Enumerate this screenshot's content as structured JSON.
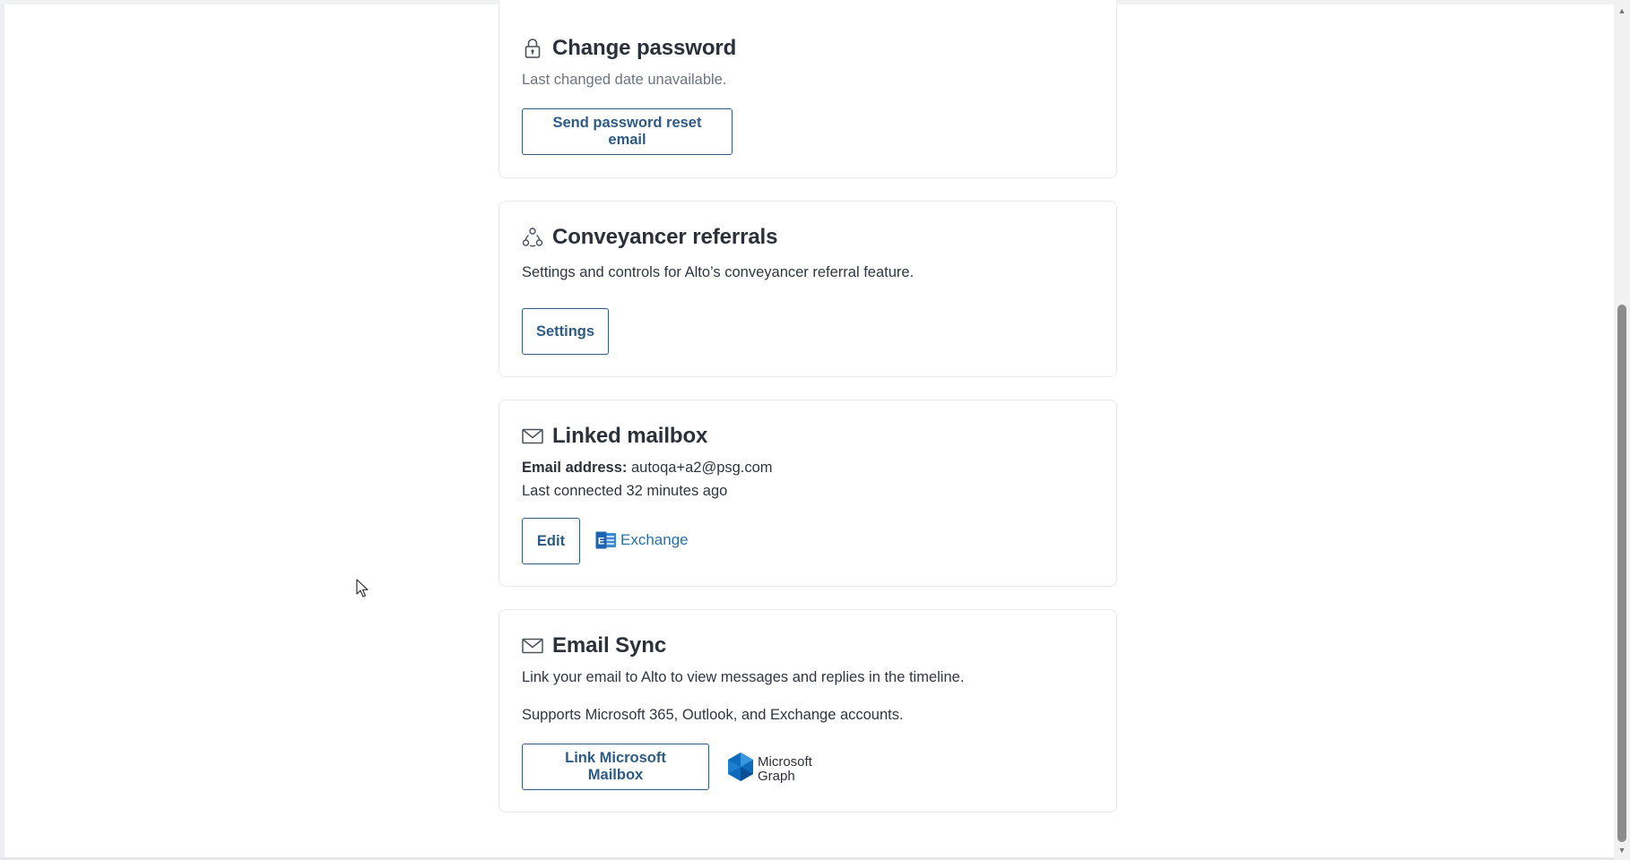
{
  "change_password": {
    "title": "Change password",
    "icon": "lock-icon",
    "subtitle": "Last changed date unavailable.",
    "button_label": "Send password reset email"
  },
  "conveyancer_referrals": {
    "title": "Conveyancer referrals",
    "icon": "referral-network-icon",
    "description": "Settings and controls for Alto’s conveyancer referral feature.",
    "button_label": "Settings"
  },
  "linked_mailbox": {
    "title": "Linked mailbox",
    "icon": "envelope-icon",
    "email_label": "Email address:",
    "email_value": "autoqa+a2@psg.com",
    "last_connected": "Last connected 32 minutes ago",
    "button_label": "Edit",
    "provider_label": "Exchange",
    "provider_icon": "exchange-logo-icon"
  },
  "email_sync": {
    "title": "Email Sync",
    "icon": "envelope-icon",
    "description": "Link your email to Alto to view messages and replies in the timeline.",
    "supports": "Supports Microsoft 365, Outlook, and Exchange accounts.",
    "button_label": "Link Microsoft Mailbox",
    "logo_line1": "Microsoft",
    "logo_line2": "Graph",
    "logo_icon": "microsoft-graph-logo-icon"
  },
  "colors": {
    "button_text": "#2e5b85",
    "button_border": "#2e5b85",
    "exchange_blue": "#2b6fa8",
    "graph_blue": "#0f6cbd",
    "heading": "#2b313a",
    "muted_text": "#6c7480"
  }
}
